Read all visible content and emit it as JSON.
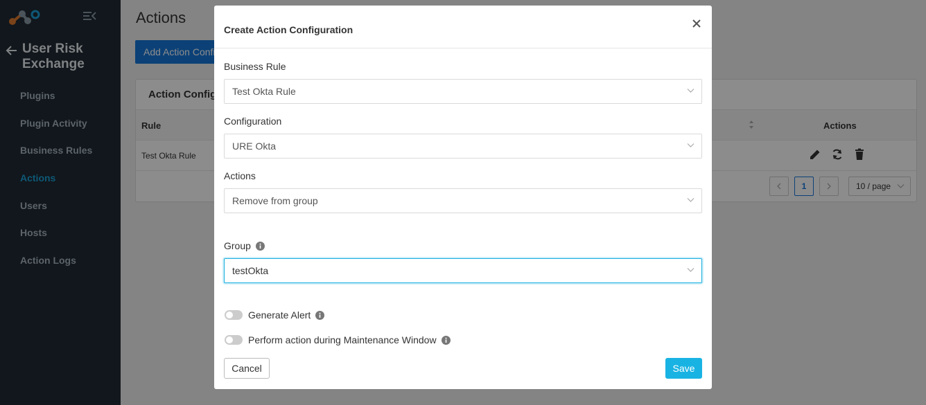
{
  "sidebar": {
    "app_title": "User Risk Exchange",
    "items": [
      {
        "label": "Plugins",
        "active": false
      },
      {
        "label": "Plugin Activity",
        "active": false
      },
      {
        "label": "Business Rules",
        "active": false
      },
      {
        "label": "Actions",
        "active": true
      },
      {
        "label": "Users",
        "active": false
      },
      {
        "label": "Hosts",
        "active": false
      },
      {
        "label": "Action Logs",
        "active": false
      }
    ]
  },
  "page": {
    "title": "Actions",
    "add_button_label": "Add Action Configuration",
    "card_title": "Action Configurations",
    "table": {
      "columns": {
        "rule": "Rule",
        "actions": "Actions"
      },
      "rows": [
        {
          "rule": "Test Okta Rule"
        }
      ]
    },
    "pagination": {
      "current_page": "1",
      "page_size": "10 / page"
    }
  },
  "modal": {
    "title": "Create Action Configuration",
    "fields": {
      "business_rule": {
        "label": "Business Rule",
        "value": "Test Okta Rule"
      },
      "configuration": {
        "label": "Configuration",
        "value": "URE Okta"
      },
      "actions": {
        "label": "Actions",
        "value": "Remove from group"
      },
      "group": {
        "label": "Group",
        "value": "testOkta"
      }
    },
    "toggles": {
      "generate_alert": {
        "label": "Generate Alert",
        "on": false
      },
      "maintenance": {
        "label": "Perform action during Maintenance Window",
        "on": false
      }
    },
    "cancel_label": "Cancel",
    "save_label": "Save"
  },
  "colors": {
    "sidebar_bg": "#1f2a33",
    "accent": "#1ba0d7",
    "primary_button": "#1677d9",
    "save_button": "#19b3e3"
  }
}
